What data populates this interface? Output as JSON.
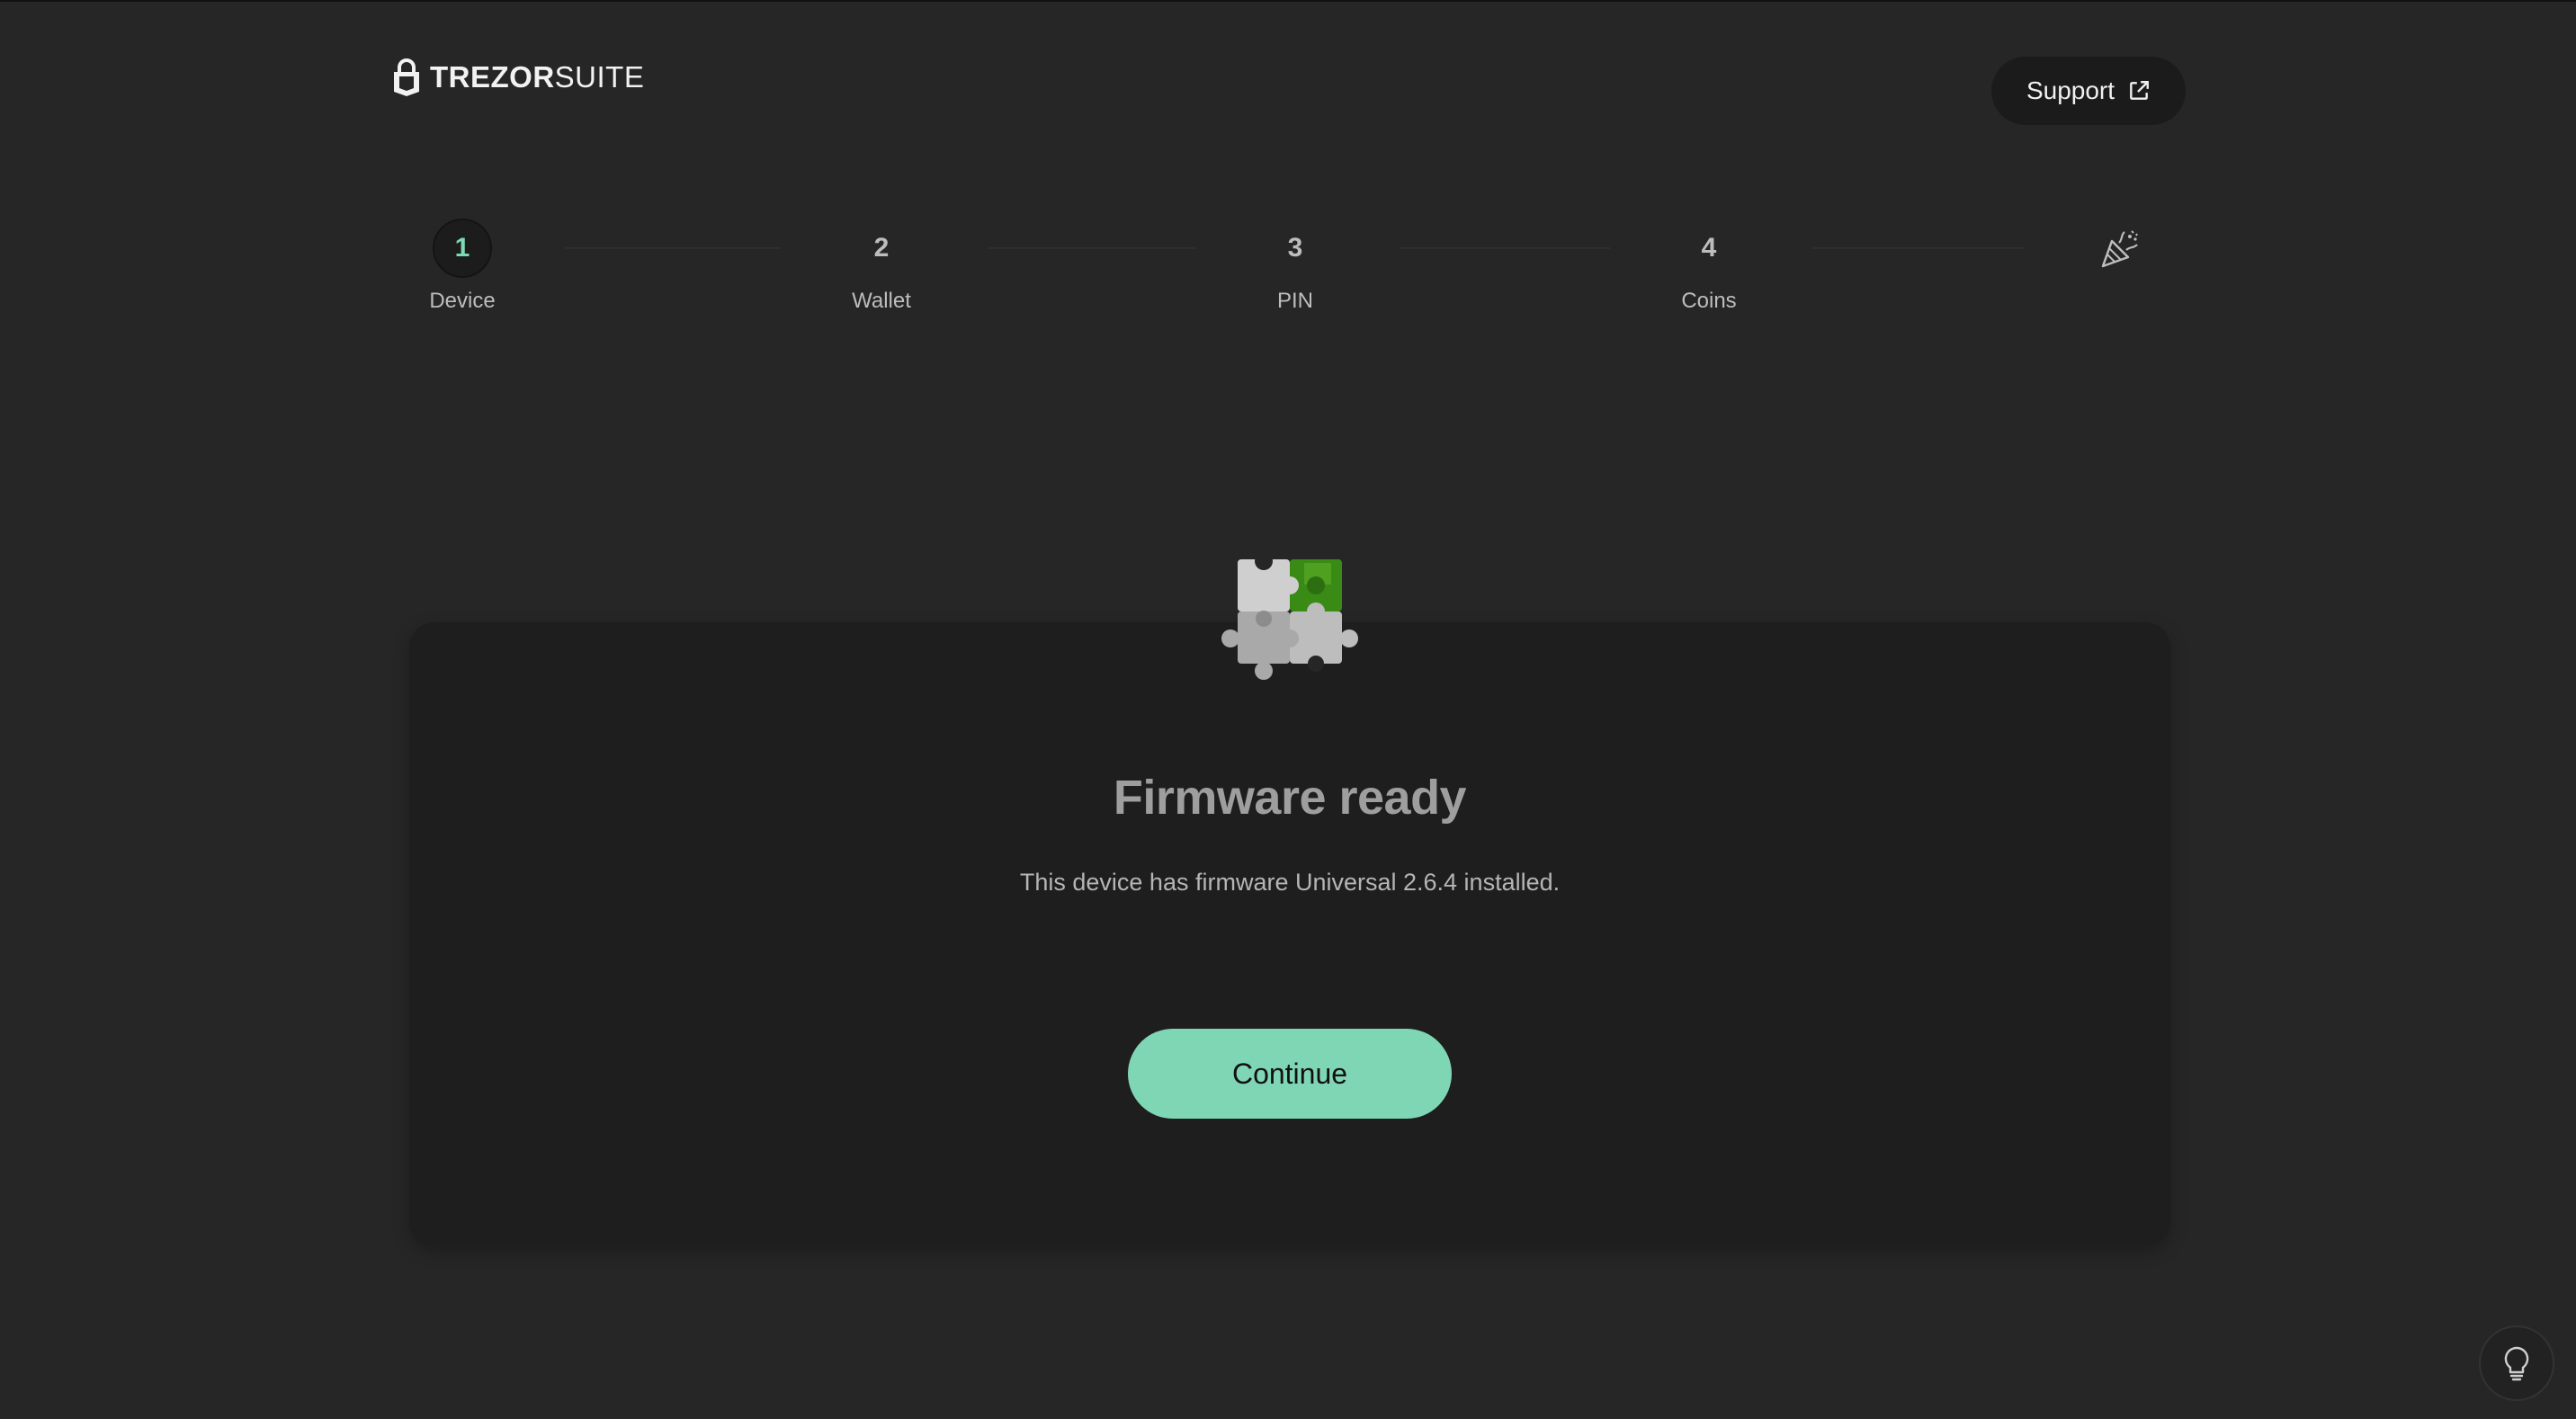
{
  "header": {
    "brand_bold": "TREZOR",
    "brand_light": "SUITE",
    "support_label": "Support"
  },
  "stepper": {
    "steps": [
      {
        "number": "1",
        "label": "Device",
        "active": true
      },
      {
        "number": "2",
        "label": "Wallet",
        "active": false
      },
      {
        "number": "3",
        "label": "PIN",
        "active": false
      },
      {
        "number": "4",
        "label": "Coins",
        "active": false
      }
    ],
    "final_icon": "party-popper-icon"
  },
  "card": {
    "illustration": "puzzle-icon",
    "title": "Firmware ready",
    "description": "This device has firmware Universal 2.6.4 installed.",
    "continue_label": "Continue"
  },
  "corner": {
    "icon": "lightbulb-icon"
  },
  "colors": {
    "background": "#262626",
    "card": "#1e1e1e",
    "accent": "#7fd6b5",
    "active_step_number": "#7ed9b4",
    "puzzle_green": "#3a8a16"
  }
}
